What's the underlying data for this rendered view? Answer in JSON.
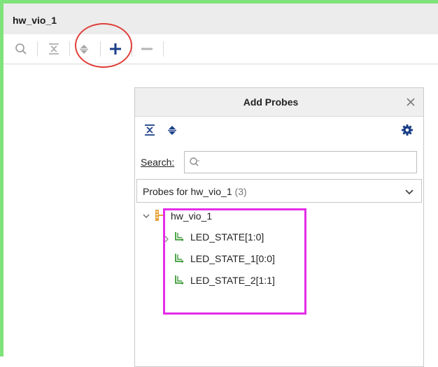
{
  "window": {
    "title": "hw_vio_1"
  },
  "toolbar": {
    "icons": [
      "search-icon",
      "collapse-all-icon",
      "expand-all-icon",
      "add-probe-icon",
      "remove-probe-icon"
    ]
  },
  "dialog": {
    "title": "Add Probes",
    "search_label": "Search:",
    "search_placeholder": "",
    "probe_list": {
      "label": "Probes for hw_vio_1",
      "count": "(3)"
    },
    "tree": {
      "root": "hw_vio_1",
      "items": [
        {
          "label": "LED_STATE[1:0]",
          "expandable": true
        },
        {
          "label": "LED_STATE_1[0:0]",
          "expandable": false
        },
        {
          "label": "LED_STATE_2[1:1]",
          "expandable": false
        }
      ]
    }
  },
  "colors": {
    "frame_border": "#7ee37a",
    "annotation_circle": "#e0403a",
    "annotation_box": "#e52ce8",
    "accent": "#1c3f87",
    "probe_icon": "#3f9b3a"
  }
}
